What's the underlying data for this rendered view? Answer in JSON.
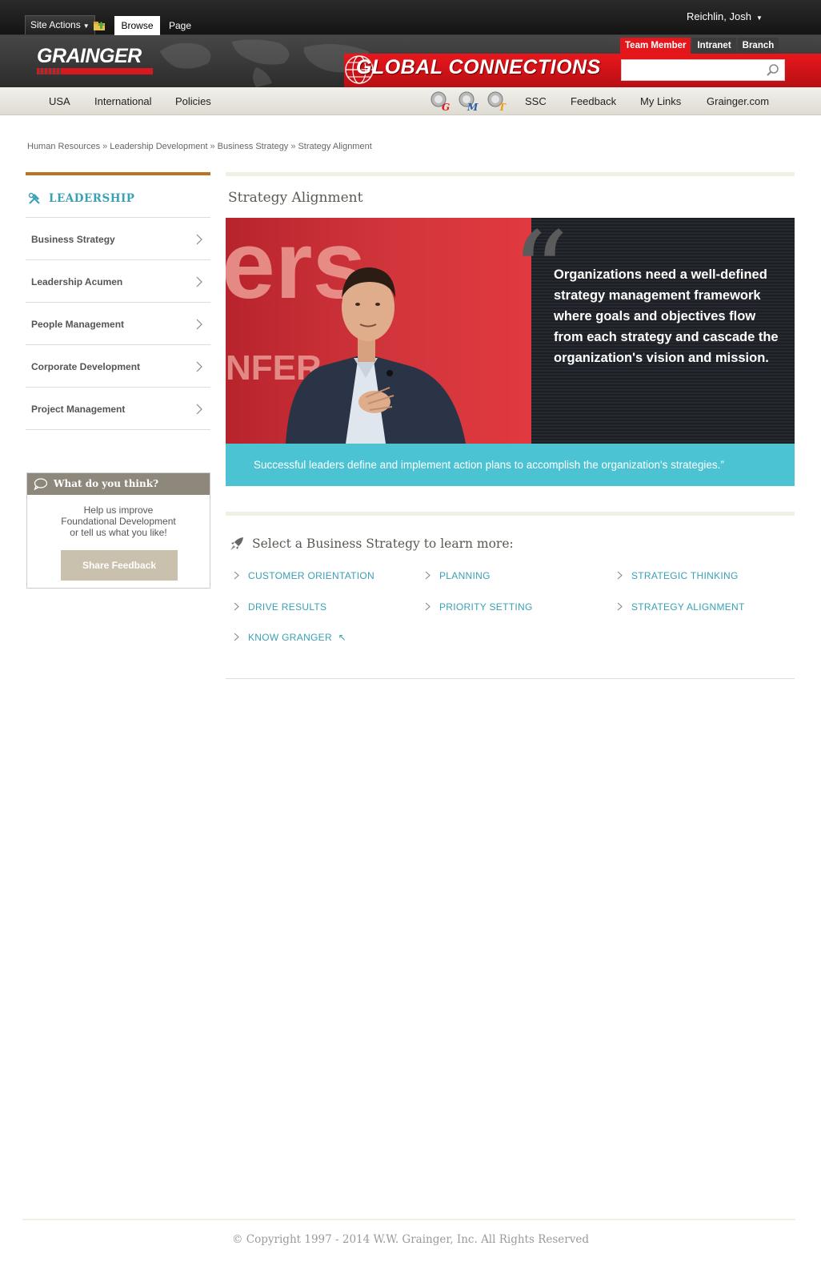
{
  "ribbon": {
    "site_actions_label": "Site Actions",
    "tabs": [
      {
        "label": "Browse",
        "active": true
      },
      {
        "label": "Page",
        "active": false
      }
    ],
    "user_name": "Reichlin, Josh"
  },
  "brand": {
    "logo_text": "GRAINGER",
    "portal_title": "GLOBAL CONNECTIONS",
    "portal_tabs": [
      {
        "label": "Team Member",
        "active": true
      },
      {
        "label": "Intranet",
        "active": false
      },
      {
        "label": "Branch",
        "active": false
      }
    ],
    "search": {
      "value": "",
      "placeholder": ""
    },
    "colors": {
      "brand_red": "#e3161b",
      "accent_teal": "#3aa0b4",
      "caption_blue": "#4bc3d3",
      "accent_orange": "#b8741f"
    }
  },
  "topnav": {
    "left": [
      "USA",
      "International",
      "Policies"
    ],
    "app_icons": [
      {
        "name": "G",
        "color": "#e3161b"
      },
      {
        "name": "M",
        "color": "#2f5ea8"
      },
      {
        "name": "T",
        "color": "#f29a1a"
      }
    ],
    "right": [
      "SSC",
      "Feedback",
      "My Links",
      "Grainger.com"
    ]
  },
  "breadcrumb": [
    "Human Resources",
    "Leadership Development",
    "Business Strategy",
    "Strategy Alignment"
  ],
  "sidebar": {
    "title": "LEADERSHIP",
    "items": [
      "Business Strategy",
      "Leadership Acumen",
      "People Management",
      "Corporate Development",
      "Project Management"
    ]
  },
  "feedback": {
    "title": "What do you think?",
    "line1": "Help us improve",
    "line2": "Foundational Development",
    "line3": "or tell us what you like!",
    "button": "Share Feedback"
  },
  "main": {
    "title": "Strategy Alignment",
    "hero_bg_word": "ers",
    "hero_bg_word2": "NFER",
    "quote_mark": "“",
    "quote": "Organizations need a well-defined strategy management framework where goals and objectives flow from each strategy and cascade the organization's vision and mission.",
    "caption": "Successful leaders define and implement action plans to accomplish the organization's strategies.”",
    "select_heading": "Select a Business Strategy to learn more:",
    "strategy_links": [
      "CUSTOMER ORIENTATION",
      "PLANNING",
      "STRATEGIC THINKING",
      "DRIVE RESULTS",
      "PRIORITY SETTING",
      "STRATEGY ALIGNMENT",
      "KNOW GRANGER"
    ],
    "external_link_glyph": "↖"
  },
  "footer": {
    "copyright": "© Copyright 1997 - 2014 W.W. Grainger, Inc. All Rights Reserved"
  }
}
